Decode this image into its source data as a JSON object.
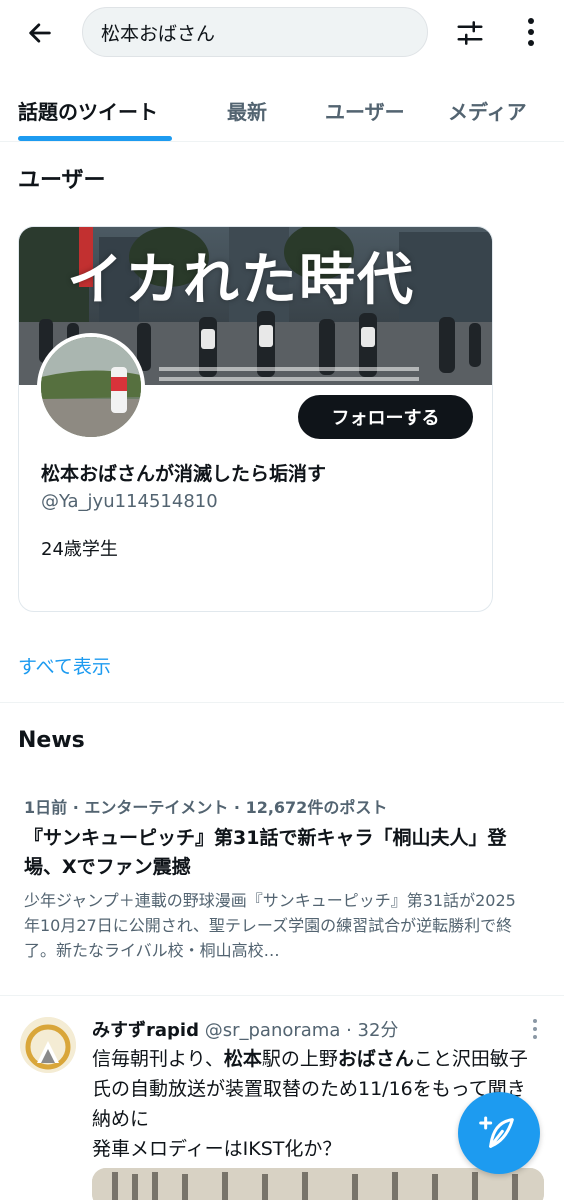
{
  "search": {
    "query": "松本おばさん"
  },
  "tabs": [
    {
      "label": "話題のツイート"
    },
    {
      "label": "最新"
    },
    {
      "label": "ユーザー"
    },
    {
      "label": "メディア"
    }
  ],
  "users_section": {
    "title": "ユーザー",
    "card": {
      "banner_text": "イカれた時代",
      "follow_label": "フォローする",
      "name": "松本おばさんが消滅したら垢消す",
      "handle": "@Ya_jyu114514810",
      "bio": "24歳学生"
    },
    "show_all": "すべて表示"
  },
  "news_section": {
    "title": "News",
    "item": {
      "meta": "1日前 · エンターテイメント · 12,672件のポスト",
      "title": "『サンキューピッチ』第31話で新キャラ「桐山夫人」登場、Xでファン震撼",
      "summary": "少年ジャンプ＋連載の野球漫画『サンキューピッチ』第31話が2025年10月27日に公開され、聖テレーズ学園の練習試合が逆転勝利で終了。新たなライバル校・桐山高校…"
    }
  },
  "tweet": {
    "author": "みすずrapid",
    "handle": "@sr_panorama",
    "sep": " · ",
    "time": "32分",
    "line1_a": "信毎朝刊より、",
    "line1_b": "松本",
    "line1_c": "駅の上野",
    "line1_d": "おばさん",
    "line1_e": "こと沢田敏子氏の自動放送が装置取替のため11/16をもって聞き納めに",
    "line2": "発車メロディーはIKST化か？"
  },
  "colors": {
    "accent": "#1d9bf0",
    "text": "#0f1419",
    "muted": "#536471"
  }
}
